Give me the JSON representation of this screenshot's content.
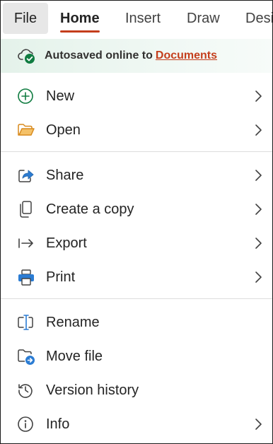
{
  "tabs": {
    "file": "File",
    "home": "Home",
    "insert": "Insert",
    "draw": "Draw",
    "design": "Desi"
  },
  "banner": {
    "text": "Autosaved online to",
    "link": "Documents",
    "icon": "cloud-check-icon"
  },
  "menu": {
    "new": "New",
    "open": "Open",
    "share": "Share",
    "copy": "Create a copy",
    "export": "Export",
    "print": "Print",
    "rename": "Rename",
    "move": "Move file",
    "history": "Version history",
    "info": "Info"
  },
  "colors": {
    "accent": "#c43e1c",
    "success": "#107c41",
    "folder": "#e8a33d",
    "blue": "#2b6cb0"
  }
}
